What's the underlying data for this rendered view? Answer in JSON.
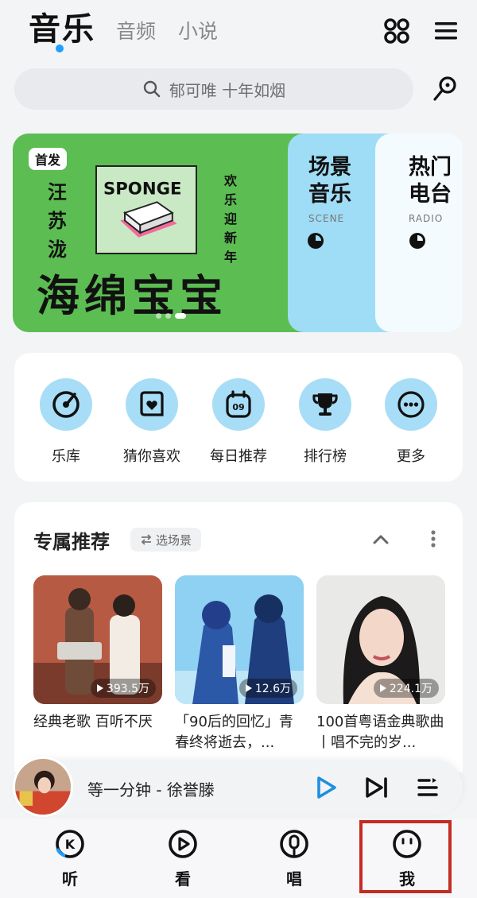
{
  "header": {
    "tabs": [
      {
        "label": "音乐",
        "active": true
      },
      {
        "label": "音频",
        "active": false
      },
      {
        "label": "小说",
        "active": false
      }
    ],
    "accent_color": "#1ea0ff",
    "icons": [
      "apps-grid-icon",
      "menu-icon"
    ]
  },
  "search": {
    "placeholder": "郁可唯 十年如烟",
    "icon": "search-icon",
    "side_icon": "mic-icon"
  },
  "banner": {
    "badge": "首发",
    "artist": "汪苏泷",
    "greeting": "欢乐迎新年",
    "album_word": "SPONGE",
    "title": "海绵宝宝",
    "bg_color": "#5cbd52",
    "page_count": 3,
    "active_page": 3,
    "cards": [
      {
        "title": "场景音乐",
        "subtitle": "SCENE",
        "color": "#9fdcf5"
      },
      {
        "title": "热门电台",
        "subtitle": "RADIO",
        "color": "#f4fbff"
      }
    ]
  },
  "quick_entries": [
    {
      "label": "乐库",
      "icon": "music-library-icon"
    },
    {
      "label": "猜你喜欢",
      "icon": "heart-box-icon"
    },
    {
      "label": "每日推荐",
      "icon": "calendar-icon",
      "day": "09"
    },
    {
      "label": "排行榜",
      "icon": "trophy-icon"
    },
    {
      "label": "更多",
      "icon": "more-icon"
    }
  ],
  "recommend": {
    "title": "专属推荐",
    "scene_button": "选场景",
    "playlists": [
      {
        "play_count": "393.5万",
        "title": "经典老歌 百听不厌"
      },
      {
        "play_count": "12.6万",
        "title": "「90后的回忆」青春终将逝去，..."
      },
      {
        "play_count": "224.1万",
        "title": "100首粤语金典歌曲丨唱不完的岁..."
      }
    ]
  },
  "player": {
    "now_playing": "等一分钟 - 徐誉滕",
    "accent_color": "#1e8fe0"
  },
  "bottom_nav": [
    {
      "label": "听",
      "icon": "listen-icon"
    },
    {
      "label": "看",
      "icon": "watch-icon"
    },
    {
      "label": "唱",
      "icon": "sing-icon"
    },
    {
      "label": "我",
      "icon": "me-icon",
      "highlighted": true
    }
  ],
  "highlight_color": "#c42c22"
}
